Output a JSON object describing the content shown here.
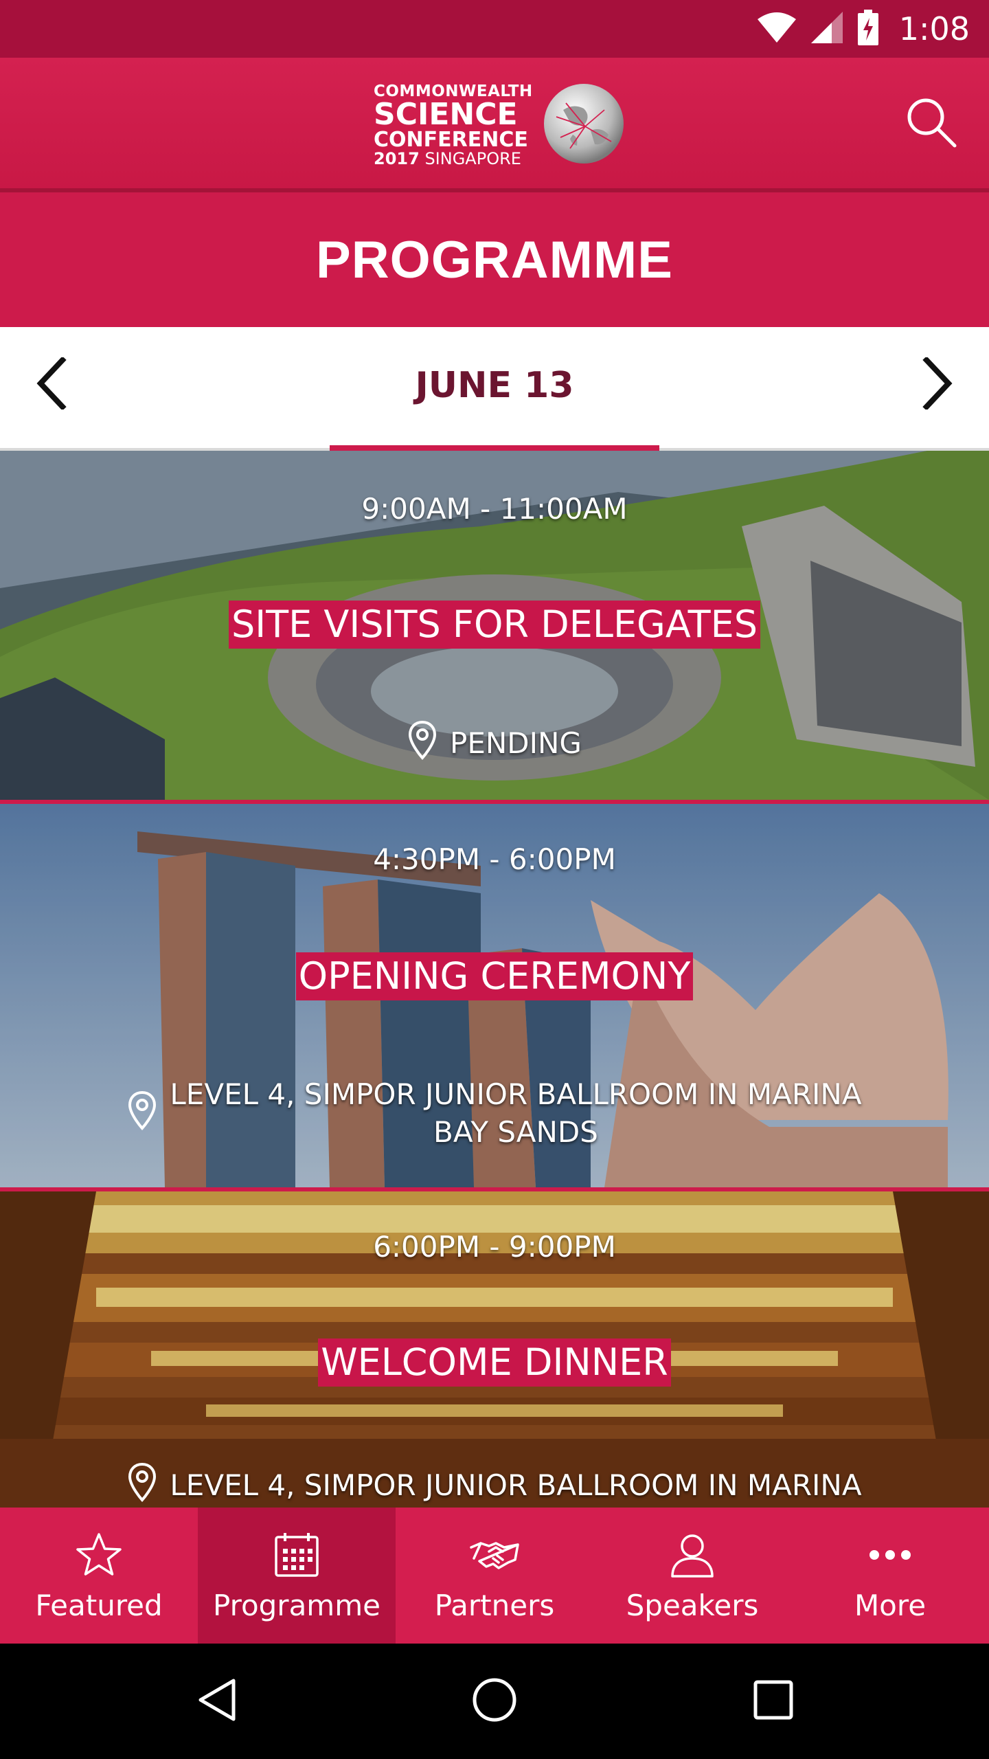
{
  "status_bar": {
    "time": "1:08"
  },
  "header": {
    "logo": {
      "line1": "COMMONWEALTH",
      "line2": "SCIENCE",
      "line3": "CONFERENCE",
      "line4_year": "2017",
      "line4_city": "SINGAPORE"
    },
    "search_icon": "search-icon"
  },
  "page_title": "PROGRAMME",
  "date_nav": {
    "date": "JUNE 13",
    "prev_icon": "chevron-left-icon",
    "next_icon": "chevron-right-icon"
  },
  "events": [
    {
      "time": "9:00AM - 11:00AM",
      "title": "SITE VISITS FOR DELEGATES",
      "location": "PENDING"
    },
    {
      "time": "4:30PM - 6:00PM",
      "title": "OPENING CEREMONY",
      "location_line1": "LEVEL 4, SIMPOR JUNIOR BALLROOM IN MARINA",
      "location_line2": "BAY SANDS"
    },
    {
      "time": "6:00PM - 9:00PM",
      "title": "WELCOME DINNER",
      "location_line1": "LEVEL 4, SIMPOR JUNIOR BALLROOM IN MARINA"
    }
  ],
  "bottom_nav": [
    {
      "label": "Featured",
      "icon": "star-icon"
    },
    {
      "label": "Programme",
      "icon": "calendar-icon",
      "active": true
    },
    {
      "label": "Partners",
      "icon": "handshake-icon"
    },
    {
      "label": "Speakers",
      "icon": "person-icon"
    },
    {
      "label": "More",
      "icon": "more-dots-icon"
    }
  ],
  "colors": {
    "brand": "#cd1b4b",
    "status_bar": "#a6103c",
    "date_text": "#6b1530"
  }
}
